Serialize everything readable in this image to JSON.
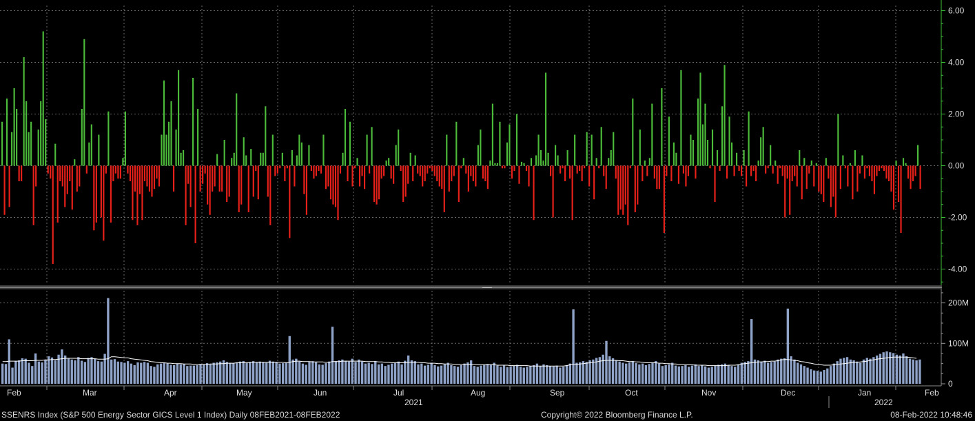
{
  "chart_data": [
    {
      "type": "bar",
      "panel": "returns",
      "ylim": [
        -4.6,
        6.2
      ],
      "yticks": [
        "6.00",
        "4.00",
        "2.00",
        "0.00",
        "-2.00",
        "-4.00"
      ],
      "ytick_values": [
        6,
        4,
        2,
        0,
        -2,
        -4
      ],
      "colors": {
        "positive": "#4cbb3a",
        "negative": "#e8201a",
        "axis": "#3ec13a"
      },
      "values": [
        1.7,
        -1.9,
        2.6,
        -1.6,
        1.3,
        3.0,
        2.2,
        -0.6,
        -0.6,
        4.2,
        2.5,
        1.3,
        1.7,
        -2.3,
        -0.8,
        1.4,
        2.5,
        5.2,
        1.8,
        -0.3,
        -0.5,
        -3.8,
        0.85,
        -2.2,
        -0.6,
        -0.8,
        -1.6,
        -1.1,
        -0.6,
        -1.7,
        0.25,
        -1.0,
        -0.8,
        2.2,
        4.9,
        -0.3,
        0.9,
        1.6,
        -2.5,
        -2.2,
        1.2,
        -2.0,
        -2.9,
        -0.3,
        2.1,
        -2.2,
        -0.6,
        -0.3,
        -0.5,
        -0.5,
        0.3,
        2.1,
        -0.3,
        -0.6,
        -2.1,
        -1.0,
        -2.3,
        -1.1,
        -2.1,
        -0.6,
        -0.8,
        -1.0,
        -1.2,
        -0.9,
        -0.5,
        -0.8,
        1.2,
        3.3,
        1.2,
        1.7,
        2.5,
        -1.0,
        1.4,
        3.7,
        0.5,
        0.6,
        -2.3,
        -0.7,
        -1.6,
        3.4,
        -3.0,
        2.2,
        -1.0,
        -0.7,
        -0.3,
        -1.5,
        -1.9,
        -1.0,
        -0.8,
        0.45,
        -1.0,
        -1.0,
        0.0,
        -1.4,
        -1.2,
        0.0,
        0.0,
        2.8,
        -1.8,
        -1.5,
        1.1,
        0.0,
        -1.8,
        0.65,
        -1.2,
        -0.2,
        -1.3,
        0.5,
        0.5,
        2.3,
        -1.2,
        -2.3,
        1.2,
        -0.4,
        -0.3,
        -0.1,
        0.5,
        -0.6,
        -0.1,
        -2.8,
        0.6,
        -0.8,
        0.4,
        1.2,
        0.9,
        -1.1,
        -1.9,
        0.8,
        -0.2,
        -0.5,
        -0.4,
        -0.2,
        -0.3,
        1.2,
        -0.9,
        -0.8,
        -1.3,
        -1.5,
        -1.6,
        -2.1,
        -0.3,
        0.5,
        2.2,
        -0.6,
        1.7,
        -0.8,
        -0.1,
        0.3,
        -0.8,
        -0.4,
        -0.9,
        1.2,
        -0.3,
        1.5,
        -1.4,
        -1.5,
        -1.3,
        -0.5,
        -0.4,
        0.2,
        0.3,
        -0.5,
        -0.7,
        0.0,
        1.4,
        -0.2,
        -1.4,
        -1.2,
        -0.7,
        0.5,
        -0.6,
        0.4,
        -0.3,
        -0.4,
        -0.8,
        -0.6,
        -0.3,
        -0.1,
        -0.2,
        -0.4,
        -0.6,
        -0.8,
        -0.9,
        -1.8,
        1.2,
        -1.0,
        -0.6,
        -0.4,
        1.7,
        -1.4,
        -0.1,
        0.3,
        -0.3,
        -1.0,
        -0.4,
        -0.6,
        -0.8,
        0.8,
        1.4,
        -0.5,
        -0.6,
        -0.9,
        0.2,
        2.4,
        0.1,
        0.0,
        1.7,
        -0.1,
        -0.1,
        0.9,
        1.6,
        -0.5,
        -0.2,
        2.0,
        -0.7,
        0.15,
        0.1,
        -0.2,
        -0.8,
        0.3,
        -2.1,
        0.4,
        1.2,
        0.6,
        0.2,
        3.6,
        0.5,
        -0.4,
        -2.0,
        0.8,
        0.4,
        -0.3,
        -0.1,
        -0.6,
        0.6,
        -0.5,
        -2.1,
        1.2,
        -0.3,
        -0.2,
        -0.6,
        -0.1,
        1.3,
        -0.8,
        1.2,
        -1.3,
        0.3,
        -0.1,
        1.5,
        -0.4,
        -0.9,
        0.3,
        0.6,
        1.3,
        -0.5,
        -1.9,
        -1.7,
        -1.9,
        -1.5,
        -2.3,
        -0.1,
        2.6,
        -1.8,
        -1.5,
        1.4,
        -0.6,
        0.2,
        -0.4,
        0.3,
        2.4,
        -0.5,
        -0.9,
        -0.9,
        3.0,
        -2.6,
        -0.4,
        1.9,
        -0.6,
        0.9,
        0.5,
        -0.7,
        3.7,
        -0.3,
        -0.8,
        -0.4,
        0.0,
        1.0,
        -0.5,
        2.6,
        3.6,
        1.6,
        2.4,
        1.0,
        -0.1,
        1.4,
        -1.4,
        0.6,
        -0.2,
        2.3,
        3.9,
        -0.5,
        1.9,
        0.9,
        -0.4,
        0.0,
        -0.2,
        -0.4,
        0.6,
        -0.8,
        2.1,
        -0.4,
        -0.2,
        -0.6,
        0.2,
        1.1,
        1.5,
        -0.3,
        -0.1,
        0.8,
        -0.3,
        0.2,
        -0.7,
        -0.1,
        -0.4,
        -2.0,
        -0.5,
        -1.9,
        -0.6,
        -0.4,
        -0.8,
        0.6,
        -1.3,
        0.3,
        -0.9,
        -0.3,
        0.2,
        -0.8,
        0.1,
        -1.0,
        -1.1,
        -1.4,
        0.3,
        -0.5,
        -1.6,
        -1.2,
        -2.0,
        2.0,
        -0.9,
        0.4,
        -0.1,
        -0.8,
        0.1,
        -1.3,
        0.6,
        -1.0,
        -0.3,
        0.4,
        -0.5,
        -0.1,
        -0.4,
        -0.6,
        -1.1,
        -0.4,
        -0.2,
        -0.1,
        -0.2,
        -0.5,
        -0.6,
        -1.0,
        -1.7,
        0.2,
        -1.4,
        -2.6,
        0.3,
        0.1,
        -0.5,
        -0.9,
        -0.6,
        -0.4,
        0.8,
        -0.9,
        -0.3,
        1.0,
        -0.6,
        -0.5,
        -0.4,
        -0.8,
        0.1,
        -0.2,
        -0.2,
        -0.3,
        -0.1,
        -0.2,
        -0.4,
        -0.5,
        -0.6,
        -0.2,
        -0.3,
        -0.4,
        -0.9,
        -0.6,
        -0.3,
        -0.1,
        -0.4,
        -0.1,
        -0.2,
        -0.8,
        0.2,
        -0.4,
        0.1,
        -0.6,
        -0.3,
        -0.2,
        -0.2,
        -0.3,
        -0.1,
        0.1,
        -0.4,
        -0.6,
        -0.2,
        -0.3,
        -0.1,
        0.0,
        -0.4,
        -0.5,
        -0.2,
        -0.3,
        -0.1,
        -0.6,
        -0.9,
        -0.6,
        -0.2,
        0.4,
        -0.1,
        -0.3,
        -0.4,
        -0.1,
        -0.2,
        -0.6,
        -0.3,
        -0.1,
        -0.2,
        -0.4,
        -0.3,
        -0.2,
        -0.1,
        -0.5,
        -0.2,
        -0.3,
        -0.2,
        -0.4,
        -0.2,
        -0.1,
        -0.3,
        -0.2,
        -0.4,
        -0.1,
        -0.3,
        -0.2,
        -0.1
      ]
    },
    {
      "type": "bar",
      "panel": "volume",
      "ylim": [
        0,
        230
      ],
      "yticks": [
        "200M",
        "100M",
        "0"
      ],
      "ytick_values": [
        200,
        100,
        0
      ],
      "colors": {
        "bar": "#8fa3c8",
        "line": "#ffffff"
      },
      "unit": "M",
      "values": []
    }
  ],
  "returns_values": [
    1.7,
    -1.9,
    2.6,
    -1.6,
    1.3,
    3.0,
    2.2,
    -0.6,
    -0.6,
    4.2,
    2.5,
    1.3,
    1.7,
    -2.3,
    -0.8,
    1.4,
    2.5,
    5.2,
    1.8,
    -0.3,
    -0.5,
    -3.8,
    0.85,
    -2.2,
    -0.6,
    -0.8,
    -1.6,
    -1.1,
    -0.6,
    -1.7,
    0.25,
    -1.0,
    -0.8,
    2.2,
    4.9,
    -0.3,
    0.9,
    1.6,
    -2.5,
    -2.2,
    1.2,
    -2.0,
    -2.9,
    -0.3,
    2.1,
    -2.2,
    -0.6,
    -0.3,
    -0.5,
    -0.5,
    0.3,
    2.1,
    -0.3,
    -0.6,
    -2.1,
    -1.0,
    -2.3,
    -1.1,
    -2.1,
    -0.6,
    -0.8,
    -1.0,
    -1.2,
    -0.9,
    -0.5,
    -0.8,
    1.2,
    3.3,
    1.2,
    1.7,
    2.5,
    -1.0,
    1.4,
    3.7,
    0.5,
    0.6,
    -2.3,
    -0.7,
    -1.6,
    3.4,
    -3.0,
    2.2,
    -1.0,
    -0.7,
    -0.3,
    -1.5,
    -1.9,
    -1.0,
    -0.8,
    0.45,
    -1.0,
    -1.0,
    1.0,
    -1.4,
    -1.2,
    0.3,
    0.5,
    2.8,
    -1.8,
    -1.5,
    1.1,
    0.4,
    -1.8,
    0.65,
    -1.2,
    -0.2,
    -1.3,
    0.5,
    0.5,
    2.3,
    -1.2,
    -2.3,
    1.2,
    -0.4,
    -0.3,
    -0.1,
    0.5,
    -0.6,
    -0.1,
    -2.8,
    0.6,
    -0.8,
    0.4,
    1.2,
    0.9,
    -1.1,
    -1.9,
    0.8,
    -0.2,
    -0.5,
    -0.4,
    -0.2,
    -0.3,
    1.2,
    -0.9,
    -0.8,
    -1.3,
    -1.5,
    -1.6,
    -2.1,
    -0.3,
    0.5,
    2.2,
    -0.6,
    1.7,
    -0.8,
    -0.1,
    0.3,
    -0.8,
    -0.4,
    -0.9,
    1.2,
    -0.3,
    1.5,
    -1.4,
    -1.5,
    -1.3,
    -0.5,
    -0.4,
    0.2,
    0.3,
    -0.5,
    -0.7,
    0.8,
    1.4,
    -0.2,
    -1.4,
    -1.2,
    -0.7,
    0.5,
    -0.6,
    0.4,
    -0.3,
    -0.4,
    -0.8,
    -0.6,
    -0.3,
    -0.1,
    -0.2,
    -0.4,
    -0.6,
    -0.8,
    -0.9,
    -1.8,
    1.2,
    -1.0,
    -0.6,
    -0.4,
    1.7,
    -1.4,
    -0.1,
    0.3,
    -0.3,
    -1.0,
    -0.4,
    -0.6,
    -0.8,
    0.8,
    1.4,
    -0.5,
    -0.6,
    -0.9,
    0.2,
    2.4,
    0.1,
    0.1,
    1.7,
    -0.1,
    -0.1,
    0.9,
    1.6,
    -0.5,
    -0.2,
    2.0,
    -0.7,
    0.15,
    0.1,
    -0.2,
    -0.8,
    0.3,
    -2.1,
    0.4,
    1.2,
    0.6,
    0.2,
    3.6,
    0.5,
    -0.4,
    -2.0,
    0.8,
    0.4,
    -0.3,
    -0.1,
    -0.6,
    0.6,
    -0.5,
    -2.1,
    1.2,
    -0.3,
    -0.2,
    -0.6,
    -0.1,
    1.3,
    -0.8,
    1.2,
    -1.3,
    0.3,
    -0.1,
    1.5,
    -0.4,
    -0.9,
    0.3,
    0.6,
    1.3,
    -0.5,
    -1.9,
    -1.7,
    -1.9,
    -1.5,
    -2.3,
    -0.1,
    2.6,
    -1.8,
    -1.5,
    1.4,
    -0.6,
    0.2,
    -0.4,
    0.3,
    2.4,
    -0.5,
    -0.9,
    -0.9,
    3.0,
    -2.6,
    -0.4,
    1.9,
    -0.6,
    0.9,
    0.5,
    -0.7,
    3.7,
    -0.3,
    -0.8,
    -0.4,
    1.2,
    1.0,
    -0.5,
    2.6,
    3.6,
    1.6,
    2.4,
    1.0,
    -0.1,
    1.4,
    -1.4,
    0.6,
    -0.2,
    2.3,
    3.9,
    -0.5,
    1.9,
    0.9,
    -0.4,
    0.5,
    -0.2,
    -0.4,
    0.6,
    -0.8,
    2.1,
    -0.4,
    -0.2,
    -0.6,
    0.2,
    1.1,
    1.5,
    -0.3,
    -0.1,
    0.8,
    -0.3,
    0.2,
    -0.7,
    -0.1,
    -0.4,
    -2.0,
    -0.5,
    -1.9,
    -0.6,
    -0.4,
    -0.8,
    0.6,
    -1.3,
    0.3,
    -0.9,
    -0.3,
    0.2,
    -0.8,
    0.1,
    -1.0,
    -1.1,
    -1.4,
    0.3,
    -0.5,
    -1.6,
    -1.2,
    -2.0,
    2.0,
    -0.9,
    0.4,
    -0.1,
    -0.8,
    0.1,
    -1.3,
    0.6,
    -1.0,
    -0.3,
    0.4,
    -0.5,
    -0.1,
    -0.4,
    -0.6,
    -1.1,
    -0.4,
    -0.2,
    -0.1,
    -0.2,
    -0.5,
    -0.6,
    -1.0,
    -1.7,
    0.2,
    -1.4,
    -2.6,
    0.3,
    0.1,
    -0.5,
    -0.9,
    -0.6,
    -0.4,
    0.8,
    -0.9
  ],
  "volume_values": [
    50,
    49,
    110,
    40,
    56,
    58,
    63,
    62,
    52,
    44,
    75,
    55,
    53,
    60,
    68,
    65,
    58,
    72,
    85,
    70,
    62,
    60,
    58,
    66,
    57,
    54,
    64,
    66,
    62,
    56,
    55,
    74,
    212,
    60,
    61,
    55,
    54,
    52,
    56,
    50,
    46,
    53,
    52,
    54,
    52,
    44,
    42,
    48,
    50,
    52,
    50,
    47,
    46,
    50,
    48,
    49,
    44,
    45,
    45,
    46,
    48,
    47,
    51,
    48,
    52,
    53,
    55,
    58,
    54,
    52,
    51,
    53,
    55,
    56,
    52,
    54,
    56,
    53,
    55,
    54,
    52,
    57,
    55,
    54,
    50,
    51,
    52,
    118,
    60,
    62,
    55,
    50,
    47,
    54,
    56,
    53,
    48,
    47,
    51,
    55,
    141,
    56,
    58,
    60,
    57,
    55,
    62,
    54,
    60,
    55,
    50,
    52,
    49,
    56,
    48,
    50,
    44,
    47,
    50,
    52,
    55,
    48,
    57,
    70,
    58,
    56,
    48,
    50,
    45,
    47,
    52,
    46,
    43,
    45,
    48,
    52,
    46,
    44,
    42,
    46,
    50,
    53,
    58,
    44,
    42,
    45,
    47,
    49,
    48,
    52,
    45,
    42,
    45,
    41,
    43,
    45,
    47,
    42,
    40,
    42,
    44,
    46,
    50,
    44,
    48,
    46,
    44,
    43,
    45,
    40,
    42,
    46,
    50,
    184,
    52,
    53,
    56,
    54,
    58,
    60,
    64,
    66,
    72,
    106,
    68,
    63,
    58,
    55,
    52,
    50,
    53,
    56,
    51,
    48,
    50,
    46,
    49,
    53,
    56,
    50,
    44,
    46,
    48,
    52,
    45,
    43,
    44,
    46,
    42,
    45,
    48,
    44,
    46,
    43,
    40,
    42,
    45,
    47,
    48,
    50,
    46,
    44,
    42,
    48,
    52,
    54,
    56,
    160,
    60,
    58,
    55,
    57,
    52,
    54,
    55,
    60,
    62,
    63,
    186,
    68,
    60,
    52,
    48,
    44,
    40,
    36,
    33,
    32,
    30,
    34,
    38,
    44,
    50,
    56,
    62,
    64,
    66,
    60,
    58,
    55,
    52,
    60,
    64,
    62,
    66,
    70,
    74,
    78,
    80,
    78,
    76,
    72,
    70,
    75,
    68,
    62,
    60,
    58,
    60
  ],
  "volume_avg": [
    55,
    55,
    56,
    56,
    56,
    56,
    57,
    57,
    57,
    57,
    58,
    58,
    58,
    59,
    59,
    60,
    60,
    61,
    62,
    63,
    63,
    63,
    63,
    63,
    62,
    62,
    62,
    62,
    62,
    61,
    61,
    61,
    62,
    67,
    67,
    66,
    65,
    64,
    64,
    62,
    61,
    60,
    59,
    58,
    57,
    55,
    54,
    53,
    52,
    52,
    51,
    51,
    50,
    50,
    50,
    49,
    49,
    49,
    48,
    48,
    48,
    48,
    48,
    49,
    49,
    49,
    50,
    50,
    51,
    51,
    51,
    52,
    52,
    52,
    52,
    53,
    53,
    53,
    53,
    53,
    53,
    53,
    53,
    53,
    53,
    53,
    52,
    53,
    55,
    56,
    56,
    55,
    55,
    55,
    54,
    54,
    54,
    54,
    53,
    53,
    55,
    55,
    55,
    56,
    56,
    56,
    56,
    56,
    56,
    56,
    55,
    55,
    55,
    55,
    54,
    54,
    53,
    53,
    52,
    52,
    52,
    52,
    52,
    53,
    53,
    53,
    53,
    52,
    52,
    51,
    51,
    51,
    50,
    50,
    49,
    49,
    49,
    48,
    48,
    48,
    48,
    48,
    48,
    48,
    47,
    47,
    47,
    47,
    47,
    47,
    46,
    46,
    46,
    46,
    45,
    45,
    45,
    45,
    45,
    45,
    44,
    44,
    44,
    44,
    44,
    44,
    44,
    44,
    44,
    44,
    44,
    45,
    47,
    48,
    48,
    49,
    50,
    51,
    52,
    53,
    54,
    56,
    57,
    58,
    58,
    58,
    58,
    57,
    57,
    56,
    55,
    55,
    54,
    54,
    53,
    52,
    52,
    52,
    52,
    51,
    51,
    50,
    50,
    49,
    49,
    48,
    48,
    47,
    47,
    47,
    46,
    46,
    46,
    46,
    45,
    45,
    45,
    45,
    45,
    45,
    46,
    46,
    46,
    47,
    49,
    50,
    51,
    52,
    53,
    54,
    54,
    55,
    55,
    56,
    56,
    57,
    59,
    60,
    60,
    59,
    58,
    57,
    55,
    54,
    52,
    51,
    49,
    48,
    47,
    46,
    46,
    46,
    47,
    48,
    49,
    50,
    51,
    52,
    53,
    53,
    54,
    55,
    56,
    58,
    59,
    61,
    62,
    63,
    64,
    65,
    66,
    66,
    66,
    66,
    66,
    65,
    64,
    63
  ],
  "x_axis": {
    "months": [
      "Feb",
      "Mar",
      "Apr",
      "May",
      "Jun",
      "Jul",
      "Aug",
      "Sep",
      "Oct",
      "Nov",
      "Dec",
      "Jan",
      "Feb"
    ],
    "years": [
      "2021",
      "2022"
    ]
  },
  "footer": {
    "left": "SSENRS Index (S&P 500 Energy Sector GICS Level 1 Index)  Daily 08FEB2021-08FEB2022",
    "center": "Copyright© 2022 Bloomberg Finance L.P.",
    "right": "08-Feb-2022 10:48:46"
  }
}
